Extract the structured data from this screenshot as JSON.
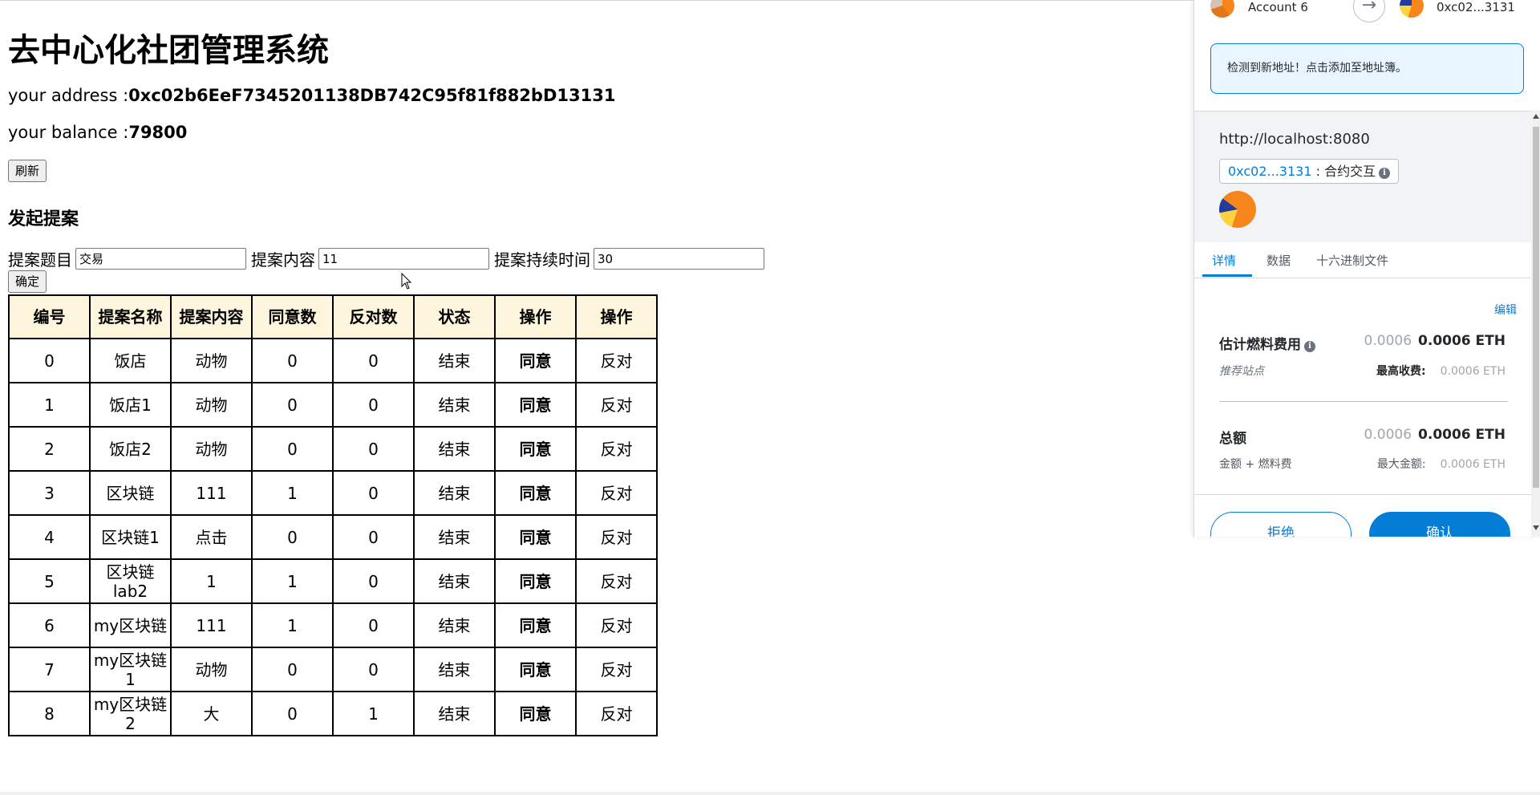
{
  "page": {
    "title": "去中心化社团管理系统",
    "address_label": "your address :",
    "address_value": "0xc02b6EeF7345201138DB742C95f81f882bD13131",
    "balance_label": "your balance :",
    "balance_value": "79800",
    "refresh_label": "刷新",
    "section_title": "发起提案",
    "form": {
      "topic_label": "提案题目",
      "topic_value": "交易",
      "content_label": "提案内容",
      "content_value": "11",
      "duration_label": "提案持续时间",
      "duration_value": "30",
      "confirm_label": "确定"
    },
    "table": {
      "headers": [
        "编号",
        "提案名称",
        "提案内容",
        "同意数",
        "反对数",
        "状态",
        "操作",
        "操作"
      ],
      "rows": [
        {
          "id": "0",
          "name": "饭店",
          "content": "动物",
          "agree": "0",
          "oppose": "0",
          "status": "结束",
          "agree_action": "同意",
          "oppose_action": "反对"
        },
        {
          "id": "1",
          "name": "饭店1",
          "content": "动物",
          "agree": "0",
          "oppose": "0",
          "status": "结束",
          "agree_action": "同意",
          "oppose_action": "反对"
        },
        {
          "id": "2",
          "name": "饭店2",
          "content": "动物",
          "agree": "0",
          "oppose": "0",
          "status": "结束",
          "agree_action": "同意",
          "oppose_action": "反对"
        },
        {
          "id": "3",
          "name": "区块链",
          "content": "111",
          "agree": "1",
          "oppose": "0",
          "status": "结束",
          "agree_action": "同意",
          "oppose_action": "反对"
        },
        {
          "id": "4",
          "name": "区块链1",
          "content": "点击",
          "agree": "0",
          "oppose": "0",
          "status": "结束",
          "agree_action": "同意",
          "oppose_action": "反对"
        },
        {
          "id": "5",
          "name": "区块链lab2",
          "content": "1",
          "agree": "1",
          "oppose": "0",
          "status": "结束",
          "agree_action": "同意",
          "oppose_action": "反对"
        },
        {
          "id": "6",
          "name": "my区块链",
          "content": "111",
          "agree": "1",
          "oppose": "0",
          "status": "结束",
          "agree_action": "同意",
          "oppose_action": "反对"
        },
        {
          "id": "7",
          "name": "my区块链1",
          "content": "动物",
          "agree": "0",
          "oppose": "0",
          "status": "结束",
          "agree_action": "同意",
          "oppose_action": "反对"
        },
        {
          "id": "8",
          "name": "my区块链2",
          "content": "大",
          "agree": "0",
          "oppose": "1",
          "status": "结束",
          "agree_action": "同意",
          "oppose_action": "反对"
        }
      ]
    }
  },
  "wallet": {
    "account_name": "Account 6",
    "to_address": "0xc02...3131",
    "alert_text": "检测到新地址！点击添加至地址簿。",
    "origin": "http://localhost:8080",
    "method_address": "0xc02...3131",
    "method_sep": " : ",
    "method_label": "合约交互",
    "tabs": [
      "详情",
      "数据",
      "十六进制文件"
    ],
    "edit_label": "编辑",
    "gas": {
      "title": "估计燃料费用",
      "fiat": "0.0006",
      "eth": "0.0006 ETH",
      "sub_left": "推荐站点",
      "max_fee_label": "最高收费:",
      "max_fee_value": "0.0006 ETH"
    },
    "total": {
      "title": "总额",
      "fiat": "0.0006",
      "eth": "0.0006 ETH",
      "sub_left": "金额 + 燃料费",
      "max_amount_label": "最大金额:",
      "max_amount_value": "0.0006 ETH"
    },
    "reject_label": "拒绝",
    "confirm_label": "确认"
  },
  "colors": {
    "accent": "#037dd6",
    "table_header_bg": "#fdf5dc",
    "alert_bg": "#eaf6ff"
  }
}
